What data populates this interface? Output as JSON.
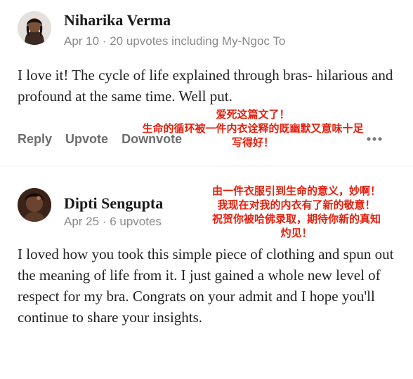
{
  "comments": [
    {
      "author": "Niharika Verma",
      "meta": "Apr 10 · 20 upvotes including My-Ngoc To",
      "body": "I love it! The cycle of life explained through bras- hilarious and profound at the same time. Well put.",
      "actions": {
        "reply": "Reply",
        "upvote": "Upvote",
        "downvote": "Downvote"
      },
      "more_icon": "more-icon",
      "annotation": {
        "line1": "爱死这篇文了！",
        "line2": "生命的循环被一件内衣诠释的既幽默又意味十足",
        "line3": "写得好！"
      }
    },
    {
      "author": "Dipti Sengupta",
      "meta": "Apr 25 · 6 upvotes",
      "body": "I loved how you took this simple piece of clothing and spun out the meaning of life from it. I just gained a whole new level of respect for my bra. Congrats on your admit and I hope you'll continue to share your insights.",
      "annotation": {
        "line1": "由一件衣服引到生命的意义，妙啊！",
        "line2": "我现在对我的内衣有了新的敬意！",
        "line3": "祝贺你被哈佛录取，期待你新的真知",
        "line4": "灼见！"
      }
    }
  ],
  "colors": {
    "annotation": "#e3200e",
    "meta": "#8a8a8a",
    "body": "#222222"
  }
}
